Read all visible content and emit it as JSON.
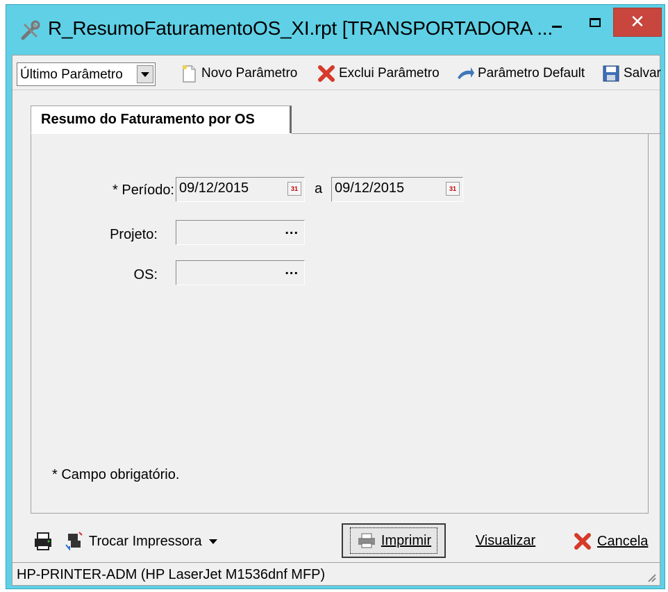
{
  "window": {
    "title": "R_ResumoFaturamentoOS_XI.rpt [TRANSPORTADORA ...",
    "minimize_label": "–",
    "maximize_label": "□",
    "close_label": "✕"
  },
  "toolbar": {
    "param_combo_value": "Último Parâmetro",
    "novo_label": "Novo Parâmetro",
    "exclui_label": "Exclui Parâmetro",
    "default_label": "Parâmetro Default",
    "salvar_label": "Salvar"
  },
  "tab": {
    "label": "Resumo do Faturamento por OS"
  },
  "form": {
    "periodo_label": "* Período:",
    "periodo_start": "09/12/2015",
    "periodo_sep": "a",
    "periodo_end": "09/12/2015",
    "projeto_label": "Projeto:",
    "projeto_value": "",
    "os_label": "OS:",
    "os_value": "",
    "lookup_label": "...",
    "calendar_glyph": "31",
    "required_note": "* Campo obrigatório."
  },
  "bottom": {
    "trocar_label": "Trocar Impressora",
    "imprimir_label": "Imprimir",
    "visualizar_label": "Visualizar",
    "cancela_label": "Cancela"
  },
  "status": {
    "printer": "HP-PRINTER-ADM (HP LaserJet M1536dnf MFP)"
  },
  "colors": {
    "titlebar": "#5fd0e6",
    "close_button": "#c8463d",
    "window_bg": "#f0f0f0"
  },
  "icons": [
    "tools-icon",
    "new-document-icon",
    "delete-x-icon",
    "default-arrow-icon",
    "save-disk-icon",
    "printer-icon",
    "swap-printer-icon",
    "calendar-icon",
    "cancel-x-icon",
    "resize-grip-icon"
  ]
}
